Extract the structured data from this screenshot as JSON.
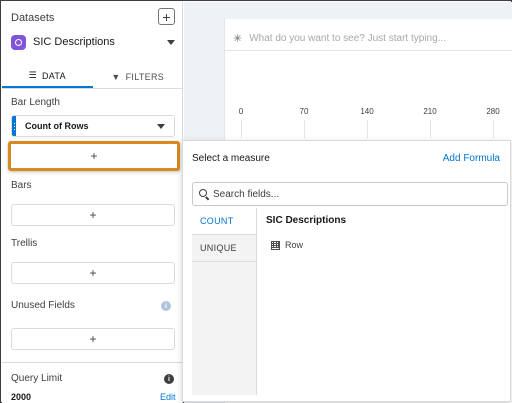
{
  "left_panel": {
    "datasets_label": "Datasets",
    "add_label": "+",
    "dataset_name": "SIC Descriptions",
    "tabs": [
      {
        "label": "DATA",
        "icon": "list-icon"
      },
      {
        "label": "FILTERS",
        "icon": "filter-icon"
      }
    ],
    "bar_length_label": "Bar Length",
    "bar_length_field": "Count of Rows",
    "add_measure_label": "+",
    "bars_label": "Bars",
    "add_bars_label": "+",
    "trellis_label": "Trellis",
    "add_trellis_label": "+",
    "unused_fields_label": "Unused Fields",
    "add_unused_label": "+",
    "query_limit_label": "Query Limit",
    "query_limit_value": "2000",
    "edit_label": "Edit"
  },
  "canvas": {
    "prompt_placeholder": "What do you want to see? Just start typing...",
    "axis_ticks": [
      "0",
      "70",
      "140",
      "210",
      "280"
    ]
  },
  "measure_popover": {
    "title": "Select a measure",
    "add_formula": "Add Formula",
    "search_placeholder": "Search fields...",
    "aggregations": [
      "COUNT",
      "UNIQUE"
    ],
    "dataset_title": "SIC Descriptions",
    "fields": [
      "Row"
    ]
  },
  "colors": {
    "accent": "#0176d3",
    "highlight": "#d98a1f",
    "dataset_icon": "#7f56d9"
  }
}
